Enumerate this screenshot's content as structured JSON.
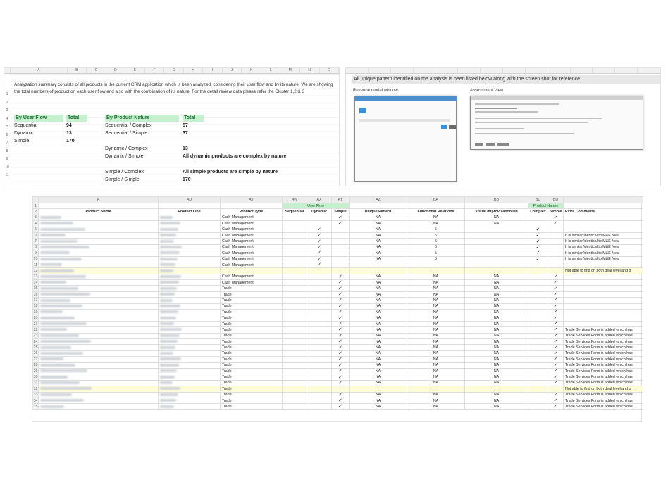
{
  "sheet1": {
    "col_headers": [
      "A",
      "B",
      "C",
      "D",
      "E",
      "F",
      "G",
      "H",
      "I",
      "J",
      "K",
      "L",
      "M",
      "N",
      "O"
    ],
    "row_numbers": [
      "1",
      "2",
      "3",
      "4",
      "5",
      "6",
      "7",
      "8",
      "9",
      "10",
      "11"
    ],
    "summary": "Analyzation summary consists of all products in the current CRM application which is been analyzed, considering their user flow and by its nature. We are showing the total numbers of product on each user flow and also with the combination of its nature. For the detail review data please refer the Cluster 1,2 & 3",
    "userflow_header": "By User Flow",
    "userflow_total_header": "Total",
    "userflow": [
      {
        "label": "Sequential",
        "total": "94"
      },
      {
        "label": "Dynamic",
        "total": "13"
      },
      {
        "label": "Simple",
        "total": "170"
      }
    ],
    "nature_header": "By Product Nature",
    "nature_total_header": "Total",
    "nature": [
      {
        "label": "Sequential / Complex",
        "total": "57"
      },
      {
        "label": "Sequential / Simple",
        "total": "37"
      },
      {
        "label": "Dynamic / Complex",
        "total": "13"
      },
      {
        "label": "Dynamic / Simple",
        "total": "All dynamic products are complex by nature"
      },
      {
        "label": "Simple / Complex",
        "total": "All simple products are simple by nature"
      },
      {
        "label": "Simple / Simple",
        "total": "170"
      }
    ]
  },
  "sheet2": {
    "note": "All unique pattern identified on the analysis is been listed below along with the screen shot for reference.",
    "label_left": "Revenue modal window",
    "label_right": "Assessment View"
  },
  "sheet3": {
    "col_letters": [
      "A",
      "AU",
      "AV",
      "AW",
      "AX",
      "AY",
      "AZ",
      "BA",
      "BB",
      "BC",
      "BD",
      ""
    ],
    "headers": [
      "Product Name",
      "Product Line",
      "Product Type",
      "Sequential",
      "Dynamic",
      "Simple",
      "Unique Pattern",
      "Functional Relations",
      "Visual Improvisation On",
      "Complex",
      "Simple",
      "Extra Comments"
    ],
    "group_userflow": "User Flow",
    "group_nature": "Product Nature",
    "check_glyph": "✓",
    "rows": [
      {
        "n": "3",
        "type": "Cash Management",
        "seq": "",
        "dyn": "",
        "sim": "✓",
        "up": "NA",
        "fr": "NA",
        "vi": "NA",
        "cx": "",
        "sp": "✓",
        "c": "",
        "hl": false
      },
      {
        "n": "4",
        "type": "Cash Management",
        "seq": "",
        "dyn": "",
        "sim": "✓",
        "up": "NA",
        "fr": "NA",
        "vi": "NA",
        "cx": "",
        "sp": "✓",
        "c": "",
        "hl": false
      },
      {
        "n": "5",
        "type": "Cash Management",
        "seq": "",
        "dyn": "✓",
        "sim": "",
        "up": "NA",
        "fr": "5",
        "vi": "",
        "cx": "✓",
        "sp": "",
        "c": "",
        "hl": false
      },
      {
        "n": "6",
        "type": "Cash Management",
        "seq": "",
        "dyn": "✓",
        "sim": "",
        "up": "NA",
        "fr": "5",
        "vi": "",
        "cx": "✓",
        "sp": "",
        "c": "It is similar/identical to M&E New",
        "hl": false
      },
      {
        "n": "7",
        "type": "Cash Management",
        "seq": "",
        "dyn": "✓",
        "sim": "",
        "up": "NA",
        "fr": "5",
        "vi": "",
        "cx": "✓",
        "sp": "",
        "c": "It is similar/identical to M&E New",
        "hl": false
      },
      {
        "n": "8",
        "type": "Cash Management",
        "seq": "",
        "dyn": "✓",
        "sim": "",
        "up": "NA",
        "fr": "5",
        "vi": "",
        "cx": "✓",
        "sp": "",
        "c": "It is similar/identical to M&E New",
        "hl": false
      },
      {
        "n": "9",
        "type": "Cash Management",
        "seq": "",
        "dyn": "✓",
        "sim": "",
        "up": "NA",
        "fr": "5",
        "vi": "",
        "cx": "✓",
        "sp": "",
        "c": "It is similar/identical to M&E New",
        "hl": false
      },
      {
        "n": "10",
        "type": "Cash Management",
        "seq": "",
        "dyn": "✓",
        "sim": "",
        "up": "NA",
        "fr": "5",
        "vi": "",
        "cx": "✓",
        "sp": "",
        "c": "It is similar/identical to M&E New",
        "hl": false
      },
      {
        "n": "11",
        "type": "Cash Management",
        "seq": "",
        "dyn": "✓",
        "sim": "",
        "up": "",
        "fr": "",
        "vi": "",
        "cx": "",
        "sp": "",
        "c": "",
        "hl": false
      },
      {
        "n": "12",
        "type": "",
        "seq": "",
        "dyn": "",
        "sim": "",
        "up": "",
        "fr": "",
        "vi": "",
        "cx": "",
        "sp": "",
        "c": "Not able to find on both deal level and p",
        "hl": true
      },
      {
        "n": "13",
        "type": "Cash Management",
        "seq": "",
        "dyn": "",
        "sim": "✓",
        "up": "NA",
        "fr": "NA",
        "vi": "NA",
        "cx": "",
        "sp": "✓",
        "c": "",
        "hl": false
      },
      {
        "n": "14",
        "type": "Cash Management",
        "seq": "",
        "dyn": "",
        "sim": "✓",
        "up": "NA",
        "fr": "NA",
        "vi": "NA",
        "cx": "",
        "sp": "✓",
        "c": "",
        "hl": false
      },
      {
        "n": "15",
        "type": "Trade",
        "seq": "",
        "dyn": "",
        "sim": "✓",
        "up": "NA",
        "fr": "NA",
        "vi": "NA",
        "cx": "",
        "sp": "✓",
        "c": "",
        "hl": false
      },
      {
        "n": "16",
        "type": "Trade",
        "seq": "",
        "dyn": "",
        "sim": "✓",
        "up": "NA",
        "fr": "NA",
        "vi": "NA",
        "cx": "",
        "sp": "✓",
        "c": "",
        "hl": false
      },
      {
        "n": "17",
        "type": "Trade",
        "seq": "",
        "dyn": "",
        "sim": "✓",
        "up": "NA",
        "fr": "NA",
        "vi": "NA",
        "cx": "",
        "sp": "✓",
        "c": "",
        "hl": false
      },
      {
        "n": "18",
        "type": "Trade",
        "seq": "",
        "dyn": "",
        "sim": "✓",
        "up": "NA",
        "fr": "NA",
        "vi": "NA",
        "cx": "",
        "sp": "✓",
        "c": "",
        "hl": false
      },
      {
        "n": "19",
        "type": "Trade",
        "seq": "",
        "dyn": "",
        "sim": "✓",
        "up": "NA",
        "fr": "NA",
        "vi": "NA",
        "cx": "",
        "sp": "✓",
        "c": "",
        "hl": false
      },
      {
        "n": "20",
        "type": "Trade",
        "seq": "",
        "dyn": "",
        "sim": "✓",
        "up": "NA",
        "fr": "NA",
        "vi": "NA",
        "cx": "",
        "sp": "✓",
        "c": "",
        "hl": false
      },
      {
        "n": "21",
        "type": "Trade",
        "seq": "",
        "dyn": "",
        "sim": "✓",
        "up": "NA",
        "fr": "NA",
        "vi": "NA",
        "cx": "",
        "sp": "✓",
        "c": "",
        "hl": false
      },
      {
        "n": "22",
        "type": "Trade",
        "seq": "",
        "dyn": "",
        "sim": "✓",
        "up": "NA",
        "fr": "NA",
        "vi": "NA",
        "cx": "",
        "sp": "✓",
        "c": "Trade Services Form is added which has",
        "hl": false
      },
      {
        "n": "23",
        "type": "Trade",
        "seq": "",
        "dyn": "",
        "sim": "✓",
        "up": "NA",
        "fr": "NA",
        "vi": "NA",
        "cx": "",
        "sp": "✓",
        "c": "Trade Services Form is added which has",
        "hl": false
      },
      {
        "n": "24",
        "type": "Trade",
        "seq": "",
        "dyn": "",
        "sim": "✓",
        "up": "NA",
        "fr": "NA",
        "vi": "NA",
        "cx": "",
        "sp": "✓",
        "c": "Trade Services Form is added which has",
        "hl": false
      },
      {
        "n": "25",
        "type": "Trade",
        "seq": "",
        "dyn": "",
        "sim": "✓",
        "up": "NA",
        "fr": "NA",
        "vi": "NA",
        "cx": "",
        "sp": "✓",
        "c": "Trade Services Form is added which has",
        "hl": false
      },
      {
        "n": "26",
        "type": "Trade",
        "seq": "",
        "dyn": "",
        "sim": "✓",
        "up": "NA",
        "fr": "NA",
        "vi": "NA",
        "cx": "",
        "sp": "✓",
        "c": "Trade Services Form is added which has",
        "hl": false
      },
      {
        "n": "27",
        "type": "Trade",
        "seq": "",
        "dyn": "",
        "sim": "✓",
        "up": "NA",
        "fr": "NA",
        "vi": "NA",
        "cx": "",
        "sp": "✓",
        "c": "Trade Services Form is added which has",
        "hl": false
      },
      {
        "n": "28",
        "type": "Trade",
        "seq": "",
        "dyn": "",
        "sim": "✓",
        "up": "NA",
        "fr": "NA",
        "vi": "NA",
        "cx": "",
        "sp": "✓",
        "c": "Trade Services Form is added which has",
        "hl": false
      },
      {
        "n": "29",
        "type": "Trade",
        "seq": "",
        "dyn": "",
        "sim": "✓",
        "up": "NA",
        "fr": "NA",
        "vi": "NA",
        "cx": "",
        "sp": "✓",
        "c": "Trade Services Form is added which has",
        "hl": false
      },
      {
        "n": "30",
        "type": "Trade",
        "seq": "",
        "dyn": "",
        "sim": "✓",
        "up": "NA",
        "fr": "NA",
        "vi": "NA",
        "cx": "",
        "sp": "✓",
        "c": "Trade Services Form is added which has",
        "hl": false
      },
      {
        "n": "31",
        "type": "Trade",
        "seq": "",
        "dyn": "",
        "sim": "✓",
        "up": "NA",
        "fr": "NA",
        "vi": "NA",
        "cx": "",
        "sp": "✓",
        "c": "Trade Services Form is added which has",
        "hl": false
      },
      {
        "n": "32",
        "type": "Trade",
        "seq": "",
        "dyn": "",
        "sim": "",
        "up": "",
        "fr": "",
        "vi": "",
        "cx": "",
        "sp": "",
        "c": "Not able to find on both deal level and p",
        "hl": true
      },
      {
        "n": "33",
        "type": "Trade",
        "seq": "",
        "dyn": "",
        "sim": "✓",
        "up": "NA",
        "fr": "NA",
        "vi": "NA",
        "cx": "",
        "sp": "✓",
        "c": "Trade Services Form is added which has",
        "hl": false
      },
      {
        "n": "34",
        "type": "Trade",
        "seq": "",
        "dyn": "",
        "sim": "✓",
        "up": "NA",
        "fr": "NA",
        "vi": "NA",
        "cx": "",
        "sp": "✓",
        "c": "Trade Services Form is added which has",
        "hl": false
      },
      {
        "n": "35",
        "type": "Trade",
        "seq": "",
        "dyn": "",
        "sim": "✓",
        "up": "NA",
        "fr": "NA",
        "vi": "NA",
        "cx": "",
        "sp": "✓",
        "c": "Trade Services Form is added which has",
        "hl": false
      }
    ]
  }
}
